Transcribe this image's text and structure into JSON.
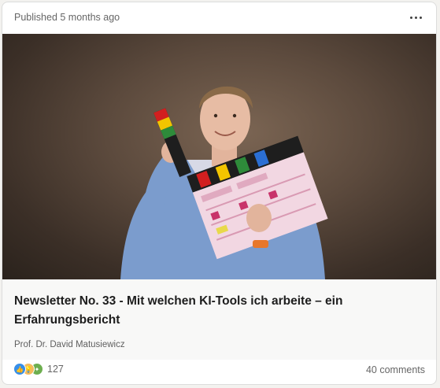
{
  "post": {
    "published": "Published 5 months ago",
    "more_icon": "more-horizontal-icon",
    "title": "Newsletter No. 33 - Mit welchen KI-Tools ich arbeite – ein Erfahrungsbericht",
    "author": "Prof. Dr. David Matusiewicz",
    "reaction_icons": [
      "like-icon",
      "insightful-icon",
      "celebrate-icon"
    ],
    "reaction_count": "127",
    "comments": "40 comments"
  },
  "colors": {
    "like": "#378fe9",
    "insightful": "#f5bb5c",
    "celebrate": "#6dae4f",
    "clapper_stripes": [
      "#d21f1f",
      "#f2c500",
      "#2e8b3a",
      "#2b6fd4"
    ]
  }
}
